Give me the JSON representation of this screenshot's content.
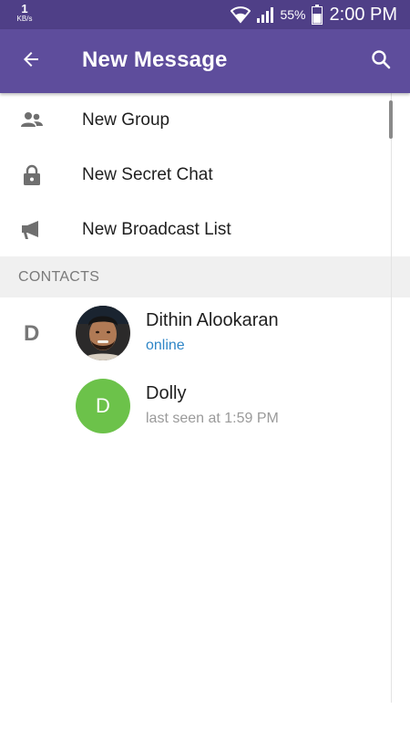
{
  "status_bar": {
    "speed_value": "1",
    "speed_unit": "KB/s",
    "battery_percent": "55%",
    "time": "2:00 PM",
    "icons": [
      "wifi-icon",
      "signal-icon",
      "battery-icon"
    ]
  },
  "app_bar": {
    "title": "New Message",
    "back_icon": "arrow-back-icon",
    "search_icon": "search-icon",
    "color": "#5e4d9c"
  },
  "menu": {
    "items": [
      {
        "label": "New Group",
        "icon": "group-icon"
      },
      {
        "label": "New Secret Chat",
        "icon": "lock-icon"
      },
      {
        "label": "New Broadcast List",
        "icon": "megaphone-icon"
      }
    ]
  },
  "section": {
    "header": "CONTACTS"
  },
  "contacts": {
    "index_letter": "D",
    "list": [
      {
        "name": "Dithin Alookaran",
        "status": "online"
      },
      {
        "name": "Dolly",
        "status": "last seen at 1:59 PM",
        "initial": "D",
        "avatar_color": "#6cc24a"
      }
    ]
  },
  "colors": {
    "status_bar": "#4f3f87",
    "online": "#2f86c7"
  }
}
